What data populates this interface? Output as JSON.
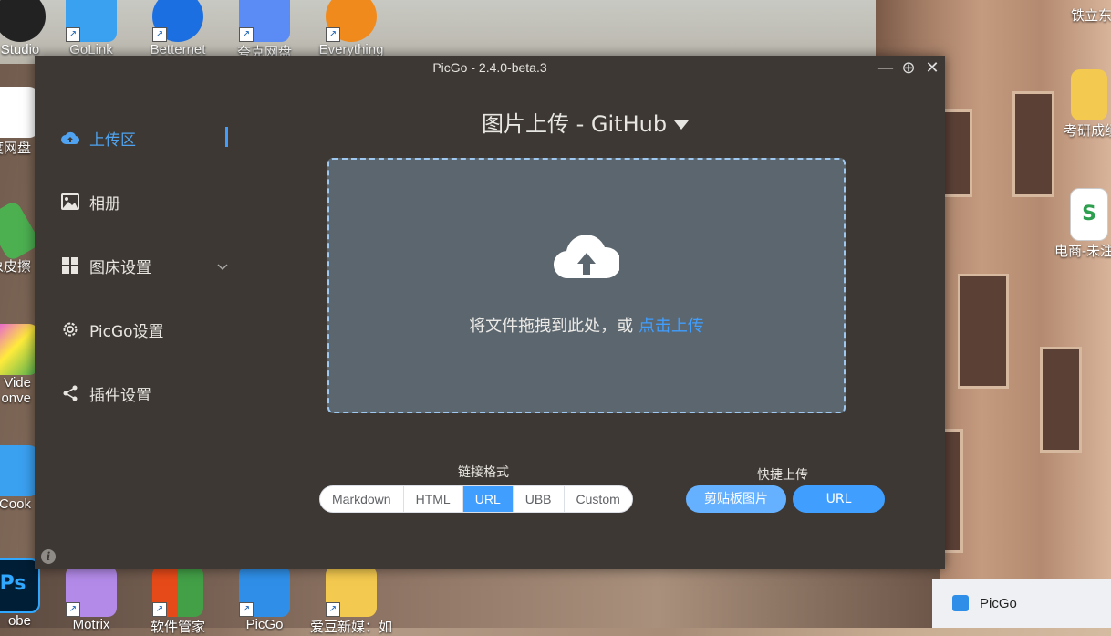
{
  "window": {
    "title": "PicGo - 2.4.0-beta.3",
    "controls": {
      "minimize": "—",
      "maximize": "⊕",
      "close": "✕"
    }
  },
  "sidebar": {
    "items": [
      {
        "label": "上传区",
        "icon": "cloud-upload-icon",
        "active": true
      },
      {
        "label": "相册",
        "icon": "image-icon",
        "active": false
      },
      {
        "label": "图床设置",
        "icon": "grid-icon",
        "active": false,
        "expandable": true
      },
      {
        "label": "PicGo设置",
        "icon": "gear-icon",
        "active": false
      },
      {
        "label": "插件设置",
        "icon": "share-icon",
        "active": false
      }
    ]
  },
  "main": {
    "title": "图片上传 - GitHub",
    "dropzone": {
      "text": "将文件拖拽到此处，或",
      "link": "点击上传"
    },
    "link_format": {
      "label": "链接格式",
      "options": [
        "Markdown",
        "HTML",
        "URL",
        "UBB",
        "Custom"
      ],
      "selected": "URL"
    },
    "quick_upload": {
      "label": "快捷上传",
      "clipboard_button": "剪贴板图片",
      "url_button": "URL"
    }
  },
  "desktop": {
    "icons_top": [
      "Studio",
      "GoLink",
      "Betternet",
      "夸克网盘",
      "Everything"
    ],
    "icons_left": [
      "度网盘",
      "象皮擦",
      "Vide",
      "onve",
      "Cook",
      "obe"
    ],
    "icons_bottom": [
      "Motrix",
      "软件管家",
      "PicGo",
      "爱豆新媒：如"
    ],
    "icons_right": [
      "铁立东",
      "考研成绩",
      "电商-未注"
    ]
  },
  "taskbar": {
    "app": "PicGo"
  },
  "colors": {
    "accent": "#409eff",
    "window_bg": "#3d3833",
    "dropzone_bg": "#5b666e"
  }
}
